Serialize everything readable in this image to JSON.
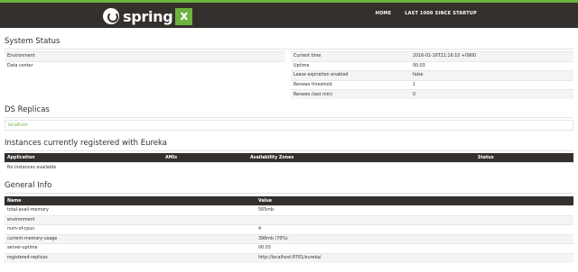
{
  "nav": {
    "brand": "spring",
    "brand_mark": "x",
    "links": [
      "HOME",
      "LAST 1000 SINCE STARTUP"
    ]
  },
  "system_status": {
    "title": "System Status",
    "left_rows": [
      {
        "k": "Environment",
        "v": ""
      },
      {
        "k": "Data center",
        "v": ""
      }
    ],
    "right_rows": [
      {
        "k": "Current time",
        "v": "2016-01-16T21:16:10 +0900"
      },
      {
        "k": "Uptime",
        "v": "00:03"
      },
      {
        "k": "Lease expiration enabled",
        "v": "false"
      },
      {
        "k": "Renews threshold",
        "v": "1"
      },
      {
        "k": "Renews (last min)",
        "v": "0"
      }
    ]
  },
  "replicas": {
    "title": "DS Replicas",
    "link": "localhost"
  },
  "instances": {
    "title": "Instances currently registered with Eureka",
    "headers": [
      "Application",
      "AMIs",
      "Availability Zones",
      "Status"
    ],
    "empty": "No instances available"
  },
  "general": {
    "title": "General Info",
    "headers": [
      "Name",
      "Value"
    ],
    "rows": [
      {
        "k": "total-avail-memory",
        "v": "565mb"
      },
      {
        "k": "environment",
        "v": ""
      },
      {
        "k": "num-of-cpus",
        "v": "4"
      },
      {
        "k": "current-memory-usage",
        "v": "396mb (70%)"
      },
      {
        "k": "server-uptime",
        "v": "00:03"
      },
      {
        "k": "registered-replicas",
        "v": "http://localhost:8761/eureka/"
      }
    ]
  },
  "colors": {
    "accent": "#6db33f",
    "dark": "#34302d"
  }
}
